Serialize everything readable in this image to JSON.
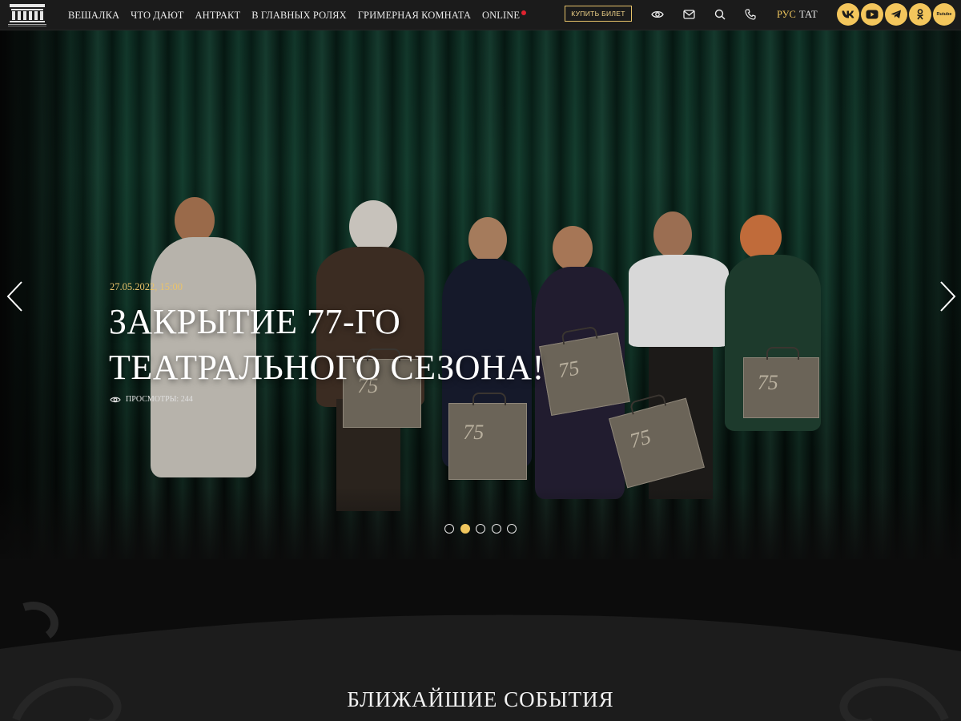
{
  "header": {
    "nav": [
      "ВЕШАЛКА",
      "ЧТО ДАЮТ",
      "АНТРАКТ",
      "В ГЛАВНЫХ РОЛЯХ",
      "ГРИМЕРНАЯ КОМНАТА",
      "ONLINE"
    ],
    "buy_ticket": "КУПИТЬ БИЛЕТ",
    "icons": [
      "eye-icon",
      "mail-icon",
      "search-icon",
      "phone-icon"
    ],
    "lang_active": "РУС",
    "lang_other": "ТАТ",
    "social": [
      "vk-icon",
      "youtube-icon",
      "telegram-icon",
      "odnoklassniki-icon",
      "rutube-icon"
    ],
    "rutube_label": "Rutube",
    "accent_color": "#f0c75e",
    "online_dot_color": "#e0222f"
  },
  "hero": {
    "date": "27.05.2022, 15:00",
    "title_line1": "ЗАКРЫТИЕ 77-ГО",
    "title_line2": "ТЕАТРАЛЬНОГО СЕЗОНА!",
    "views_label": "ПРОСМОТРЫ: 244",
    "slides_total": 5,
    "active_slide": 2,
    "bag_mark": "75"
  },
  "section": {
    "title": "БЛИЖАЙШИЕ СОБЫТИЯ"
  }
}
